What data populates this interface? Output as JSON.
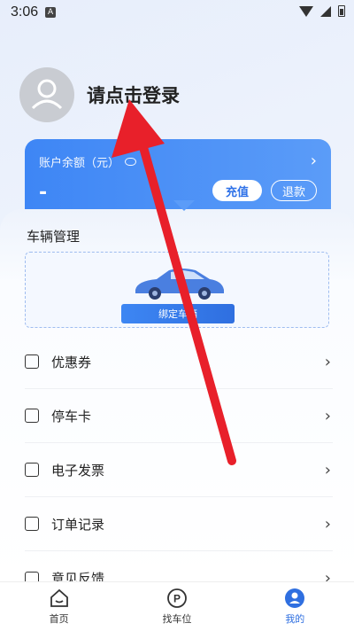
{
  "status_bar": {
    "time": "3:06",
    "notif_glyph": "A"
  },
  "profile": {
    "login_text": "请点击登录"
  },
  "balance_card": {
    "label": "账户余额（元）",
    "value": "-",
    "recharge_label": "充值",
    "refund_label": "退款",
    "chevron": "›"
  },
  "vehicle": {
    "section_title": "车辆管理",
    "bind_label": "绑定车辆"
  },
  "menu": {
    "items": [
      {
        "label": "优惠券",
        "icon": "coupon-icon"
      },
      {
        "label": "停车卡",
        "icon": "parking-card-icon"
      },
      {
        "label": "电子发票",
        "icon": "invoice-icon"
      },
      {
        "label": "订单记录",
        "icon": "order-icon"
      },
      {
        "label": "意见反馈",
        "icon": "feedback-icon"
      }
    ],
    "chevron": "›"
  },
  "tab_bar": {
    "tabs": [
      {
        "label": "首页",
        "icon": "home-icon"
      },
      {
        "label": "找车位",
        "icon": "parking-icon"
      },
      {
        "label": "我的",
        "icon": "profile-icon"
      }
    ]
  },
  "colors": {
    "accent": "#2f6fe0",
    "card": "#3e86f5",
    "arrow": "#e8202a"
  }
}
